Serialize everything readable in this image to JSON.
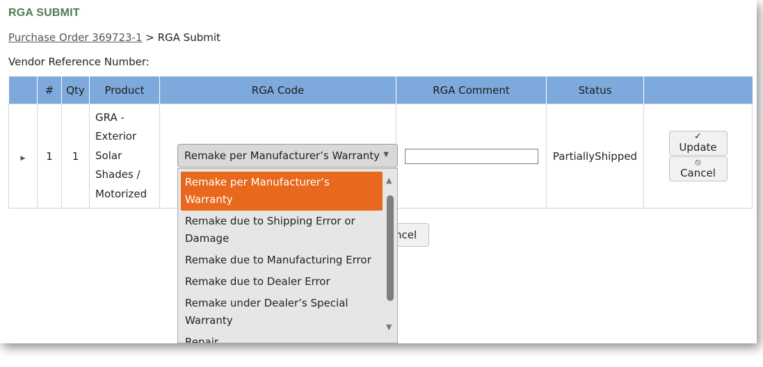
{
  "page_title": "RGA SUBMIT",
  "breadcrumb": {
    "link": "Purchase Order 369723-1",
    "separator": " > ",
    "current": "RGA Submit"
  },
  "vendor_reference_label": "Vendor Reference Number:",
  "table": {
    "headers": [
      "",
      "#",
      "Qty",
      "Product",
      "RGA Code",
      "RGA Comment",
      "Status",
      ""
    ],
    "row": {
      "number": "1",
      "qty": "1",
      "product_lines": [
        "GRA -",
        "Exterior",
        "Solar",
        "Shades /",
        "Motorized"
      ],
      "rga_comment_value": "",
      "status": "PartiallyShipped",
      "update_label": "Update",
      "cancel_label": "Cancel"
    }
  },
  "select": {
    "value": "Remake per Manufacturer’s Warranty",
    "options": [
      "Remake per Manufacturer’s Warranty",
      "Remake due to Shipping Error or Damage",
      "Remake due to Manufacturing Error",
      "Remake due to Dealer Error",
      "Remake under Dealer’s Special Warranty",
      "Repair"
    ]
  },
  "bottom_cancel_partial": "ncel",
  "colors": {
    "title_green": "#4d7a52",
    "header_blue": "#7ea9dc",
    "selected_orange": "#e8681d"
  }
}
